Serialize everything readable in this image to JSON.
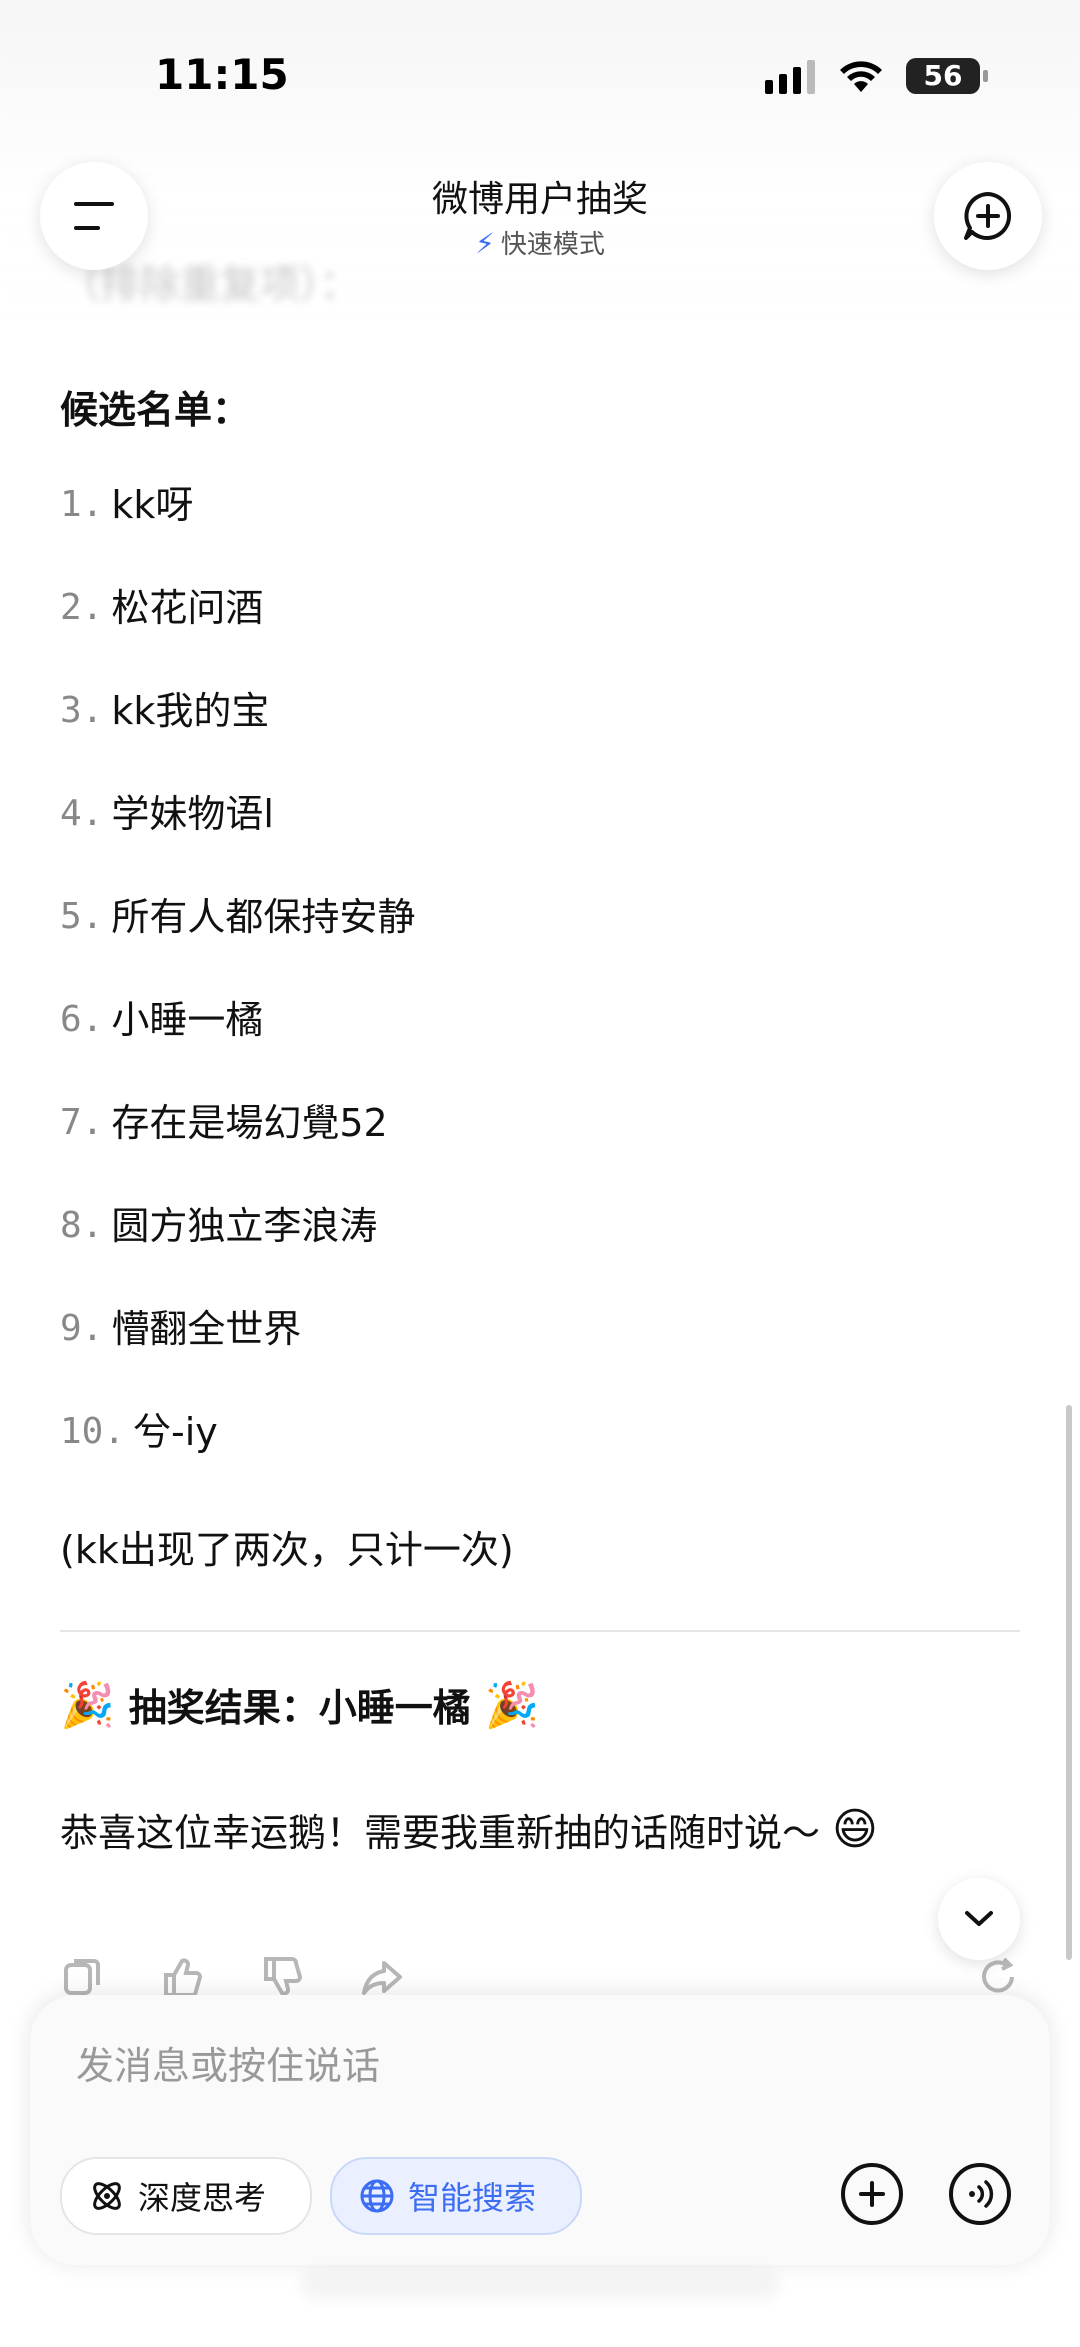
{
  "status_bar": {
    "time": "11:15",
    "battery": "56"
  },
  "header": {
    "title": "微博用户抽奖",
    "mode": "快速模式"
  },
  "blurred_text": {
    "line1": "（排除重复项）："
  },
  "content": {
    "heading": "候选名单：",
    "candidates": [
      {
        "num": "1.",
        "name": "kk呀"
      },
      {
        "num": "2.",
        "name": "松花问酒"
      },
      {
        "num": "3.",
        "name": "kk我的宝"
      },
      {
        "num": "4.",
        "name": "学妹物语l"
      },
      {
        "num": "5.",
        "name": "所有人都保持安静"
      },
      {
        "num": "6.",
        "name": "小睡一橘"
      },
      {
        "num": "7.",
        "name": "存在是場幻覺52"
      },
      {
        "num": "8.",
        "name": "圆方独立李浪涛"
      },
      {
        "num": "9.",
        "name": "懵翻全世界"
      },
      {
        "num": "10.",
        "name": "兮-iy"
      }
    ],
    "note": "(kk出现了两次，只计一次)",
    "result": "抽奖结果：小睡一橘",
    "congrats": "恭喜这位幸运鹅！需要我重新抽的话随时说～"
  },
  "input": {
    "placeholder": "发消息或按住说话",
    "deep_think_label": "深度思考",
    "smart_search_label": "智能搜索"
  },
  "colors": {
    "accent": "#3d6df2",
    "text": "#111111",
    "muted": "#888888"
  },
  "icons": [
    "menu-icon",
    "new-chat-icon",
    "bolt-icon",
    "chevron-down-icon",
    "copy-icon",
    "thumb-up-icon",
    "thumb-down-icon",
    "share-icon",
    "refresh-icon",
    "deep-think-icon",
    "globe-icon",
    "plus-icon",
    "voice-icon"
  ]
}
